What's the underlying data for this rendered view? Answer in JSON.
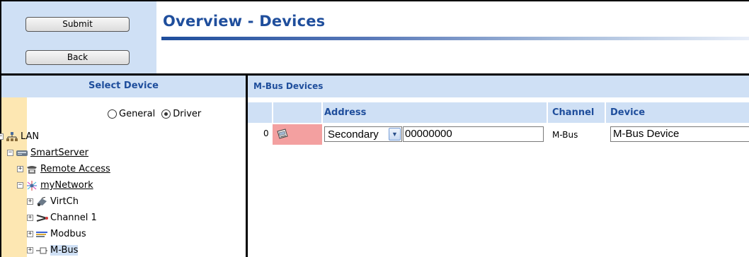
{
  "buttons": {
    "submit": "Submit",
    "back": "Back"
  },
  "page": {
    "title": "Overview - Devices"
  },
  "left_panel": {
    "header": "Select Device",
    "radio_options": [
      {
        "label": "General",
        "selected": false
      },
      {
        "label": "Driver",
        "selected": true
      }
    ]
  },
  "tree": [
    {
      "label": "LAN",
      "icon": "network-icon",
      "expanded": true,
      "link": false
    },
    {
      "label": "SmartServer",
      "icon": "server-icon",
      "expanded": true,
      "link": true
    },
    {
      "label": "Remote Access",
      "icon": "phone-icon",
      "expanded": false,
      "link": true
    },
    {
      "label": "myNetwork",
      "icon": "network-star-icon",
      "expanded": true,
      "link": true
    },
    {
      "label": "VirtCh",
      "icon": "virtual-channel-icon",
      "expanded": false,
      "link": false
    },
    {
      "label": "Channel 1",
      "icon": "channel-icon",
      "expanded": false,
      "link": false
    },
    {
      "label": "Modbus",
      "icon": "modbus-icon",
      "expanded": false,
      "link": false
    },
    {
      "label": "M-Bus",
      "icon": "mbus-icon",
      "expanded": false,
      "link": false,
      "selected": true
    }
  ],
  "right_panel": {
    "header": "M-Bus Devices",
    "columns": {
      "address": "Address",
      "channel": "Channel",
      "device": "Device"
    },
    "rows": [
      {
        "index": "0",
        "address_mode": "Secondary",
        "address": "00000000",
        "channel": "M-Bus",
        "device": "M-Bus Device"
      }
    ]
  },
  "colors": {
    "accent": "#1f4e9c",
    "panel_bg": "#cfe0f5",
    "tree_strip": "#fde7b2",
    "device_cell": "#f3a0a0"
  }
}
